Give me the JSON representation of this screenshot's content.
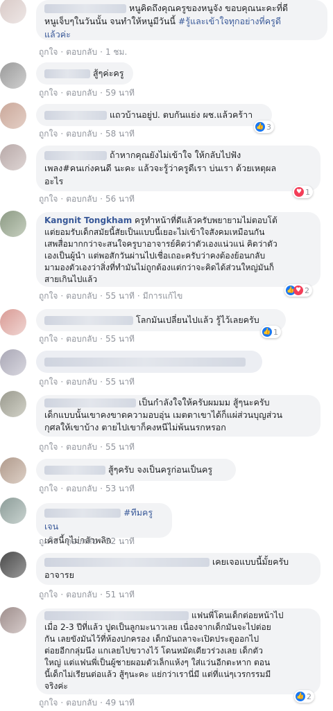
{
  "action_like": "ถูกใจ",
  "action_reply": "ตอบกลับ",
  "action_edited": "มีการแก้ไข",
  "separator": "·",
  "like_icon": "like-icon",
  "love_icon": "love-icon",
  "comments": [
    {
      "author": "",
      "text_lines": [
        "หนูคิดถึงคุณครูของหนูจัง ขอบคุณนะคะที่ดี",
        "หนูเจ็บๆในวันนั้น จนทำให้หนูมีวันนี้ "
      ],
      "tag": "#รู้และเข้าใจทุกอย่างที่ครูดี",
      "tag2": "แล้วค่ะ",
      "time": "1 ชม."
    },
    {
      "author": "",
      "text": "สู้ๆค่ะครู",
      "time": "59 นาที"
    },
    {
      "author": "",
      "text": "แถวบ้านอยู่ป. ตบกันแย่ง ผช.แล้วคร้าา",
      "time": "58 นาที",
      "reaction_count": "3"
    },
    {
      "author": "",
      "text_lines": [
        "ถ้าหากคุณยังไม่เข้าใจ ให้กลับไปฟัง",
        "เพลง#คนเก่งคนดี นะคะ แล้วจะรู้ว่าครูดีเรา บ่นเรา ด้วยเหตุผล",
        "อะไร"
      ],
      "time": "56 นาที",
      "reaction_count": "1"
    },
    {
      "author": "Kangnit Tongkham",
      "text_lines": [
        "ครูทำหน้าที่ดีแล้วครับพยายามไม่ตอบโต้",
        "แต่ยอมรับเด็กสมัยนี้สัยเป็นแบบนี้เยอะไม่เข้าใจสังคมเหมือนกัน",
        "เสพสื่อมากกว่าจะสนใจครูบาอาจารย์คิดว่าตัวเองแน่วแน่ คิดว่าตัว",
        "เองเป็นผู้นำ แต่พอสักวันผ่านไปเชื่อเถอะครับว่าคงต้องย้อนกลับ",
        "มามองตัวเองว่าสิ่งที่ทำมันไม่ถูกต้องแต่กว่าจะคิดได้ส่วนใหญ่มันก็",
        "สายเกินไปแล้ว"
      ],
      "time": "55 นาที",
      "reaction_count": "2"
    },
    {
      "author": "",
      "text": "โลกมันเปลี่ยนไปแล้ว รู้ไว้เลยครับ",
      "time": "55 นาที",
      "reaction_count": "1"
    },
    {
      "author": "",
      "text": "",
      "time": "55 นาที"
    },
    {
      "author": "",
      "text_lines": [
        "เป็นกำลังใจให้ครับผมมม สู้ๆนะครับ",
        "เด็กแบบนั้นเขาคงขาดความอบอุ่น เมตตาเขาได้ก็แผ่ส่วนบุญส่วน",
        "กุศลให้เขาบ้าง ตายไปเขาก็คงหนีไม่พ้นนรกหรอก"
      ],
      "time": "55 นาที"
    },
    {
      "author": "",
      "text": "สู้ๆครับ จงเป็นครูก่อนเป็นครู",
      "time": "53 นาที"
    },
    {
      "author": "",
      "tag": "#ทีมครูเจน",
      "text": "เคสนี้กุไม่กลัวพลิก",
      "time": "52 นาที"
    },
    {
      "author": "",
      "text_lines": [
        "เคยเจอแบบนี้มั้ยครับ",
        "อาจารย"
      ],
      "time": "51 นาที"
    },
    {
      "author": "",
      "text_lines": [
        "แฟนพี่โดนเด็กต่อยหน้าไป",
        "เมื่อ 2-3 ปีที่แล้ว ปูดเป็นลูกมะนาวเลย เนื่องจากเด็กมันจะไปต่อย",
        "กัน เลยขังมันไว้ที่ห้องปกครอง เด็กมันถลาจะเปิดประตูออกไป",
        "ต่อยอีกกลุ่มนึง แกเลยไปขวางไว้ โดนหมัดเดียวร่วงเลย เด็กตัว",
        "ใหญ่ แต่แฟนพี่เป็นผู้ชายผอมตัวเล็กแห้งๆ ใส่แว่นอีกตะหาก ตอน",
        "นี้เด็กไม่เรียนต่อแล้ว สู้ๆนะคะ แย่กว่าเรานี่มี แต่ที่แน่ๆเวรกรรมมี",
        "จริงค่ะ"
      ],
      "time": "49 นาที",
      "reaction_count": "2"
    }
  ]
}
